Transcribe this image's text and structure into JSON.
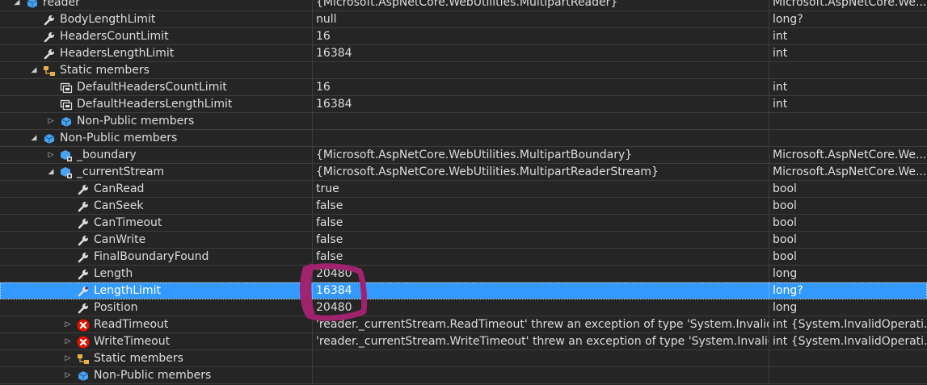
{
  "rows": [
    {
      "indent": 0,
      "expander": "expanded",
      "icon": "field-object-icon",
      "name": "reader",
      "value": "{Microsoft.AspNetCore.WebUtilities.MultipartReader}",
      "type": "Microsoft.AspNetCore.We..."
    },
    {
      "indent": 1,
      "expander": "none",
      "icon": "property-wrench-icon",
      "name": "BodyLengthLimit",
      "value": "null",
      "type": "long?"
    },
    {
      "indent": 1,
      "expander": "none",
      "icon": "property-wrench-icon",
      "name": "HeadersCountLimit",
      "value": "16",
      "type": "int"
    },
    {
      "indent": 1,
      "expander": "none",
      "icon": "property-wrench-icon",
      "name": "HeadersLengthLimit",
      "value": "16384",
      "type": "int"
    },
    {
      "indent": 1,
      "expander": "expanded",
      "icon": "static-members-icon",
      "name": "Static members",
      "value": "",
      "type": ""
    },
    {
      "indent": 2,
      "expander": "none",
      "icon": "constant-icon",
      "name": "DefaultHeadersCountLimit",
      "value": "16",
      "type": "int"
    },
    {
      "indent": 2,
      "expander": "none",
      "icon": "constant-icon",
      "name": "DefaultHeadersLengthLimit",
      "value": "16384",
      "type": "int"
    },
    {
      "indent": 2,
      "expander": "collapsed",
      "icon": "field-object-icon",
      "name": "Non-Public members",
      "value": "",
      "type": ""
    },
    {
      "indent": 1,
      "expander": "expanded",
      "icon": "field-object-icon",
      "name": "Non-Public members",
      "value": "",
      "type": ""
    },
    {
      "indent": 2,
      "expander": "collapsed",
      "icon": "private-field-icon",
      "name": "_boundary",
      "value": "{Microsoft.AspNetCore.WebUtilities.MultipartBoundary}",
      "type": "Microsoft.AspNetCore.We..."
    },
    {
      "indent": 2,
      "expander": "expanded",
      "icon": "private-field-icon",
      "name": "_currentStream",
      "value": "{Microsoft.AspNetCore.WebUtilities.MultipartReaderStream}",
      "type": "Microsoft.AspNetCore.We..."
    },
    {
      "indent": 3,
      "expander": "none",
      "icon": "property-wrench-icon",
      "name": "CanRead",
      "value": "true",
      "type": "bool"
    },
    {
      "indent": 3,
      "expander": "none",
      "icon": "property-wrench-icon",
      "name": "CanSeek",
      "value": "false",
      "type": "bool"
    },
    {
      "indent": 3,
      "expander": "none",
      "icon": "property-wrench-icon",
      "name": "CanTimeout",
      "value": "false",
      "type": "bool"
    },
    {
      "indent": 3,
      "expander": "none",
      "icon": "property-wrench-icon",
      "name": "CanWrite",
      "value": "false",
      "type": "bool"
    },
    {
      "indent": 3,
      "expander": "none",
      "icon": "property-wrench-icon",
      "name": "FinalBoundaryFound",
      "value": "false",
      "type": "bool"
    },
    {
      "indent": 3,
      "expander": "none",
      "icon": "property-wrench-icon",
      "name": "Length",
      "value": "20480",
      "type": "long"
    },
    {
      "indent": 3,
      "expander": "none",
      "icon": "property-wrench-icon",
      "name": "LengthLimit",
      "value": "16384",
      "type": "long?",
      "selected": true
    },
    {
      "indent": 3,
      "expander": "none",
      "icon": "property-wrench-icon",
      "name": "Position",
      "value": "20480",
      "type": "long"
    },
    {
      "indent": 3,
      "expander": "collapsed",
      "icon": "error-icon",
      "name": "ReadTimeout",
      "value": "'reader._currentStream.ReadTimeout' threw an exception of type 'System.InvalidOp...",
      "type": "int {System.InvalidOperati..."
    },
    {
      "indent": 3,
      "expander": "collapsed",
      "icon": "error-icon",
      "name": "WriteTimeout",
      "value": "'reader._currentStream.WriteTimeout' threw an exception of type 'System.InvalidOp...",
      "type": "int {System.InvalidOperati..."
    },
    {
      "indent": 3,
      "expander": "collapsed",
      "icon": "static-members-icon",
      "name": "Static members",
      "value": "",
      "type": ""
    },
    {
      "indent": 3,
      "expander": "collapsed",
      "icon": "field-object-icon",
      "name": "Non-Public members",
      "value": "",
      "type": ""
    }
  ],
  "colors": {
    "background": "#252526",
    "grid_line": "#3c3c3c",
    "selection": "#3399ff",
    "annotation": "#a0236e",
    "icon_blue": "#4aa3f0",
    "error_red": "#e51400"
  }
}
